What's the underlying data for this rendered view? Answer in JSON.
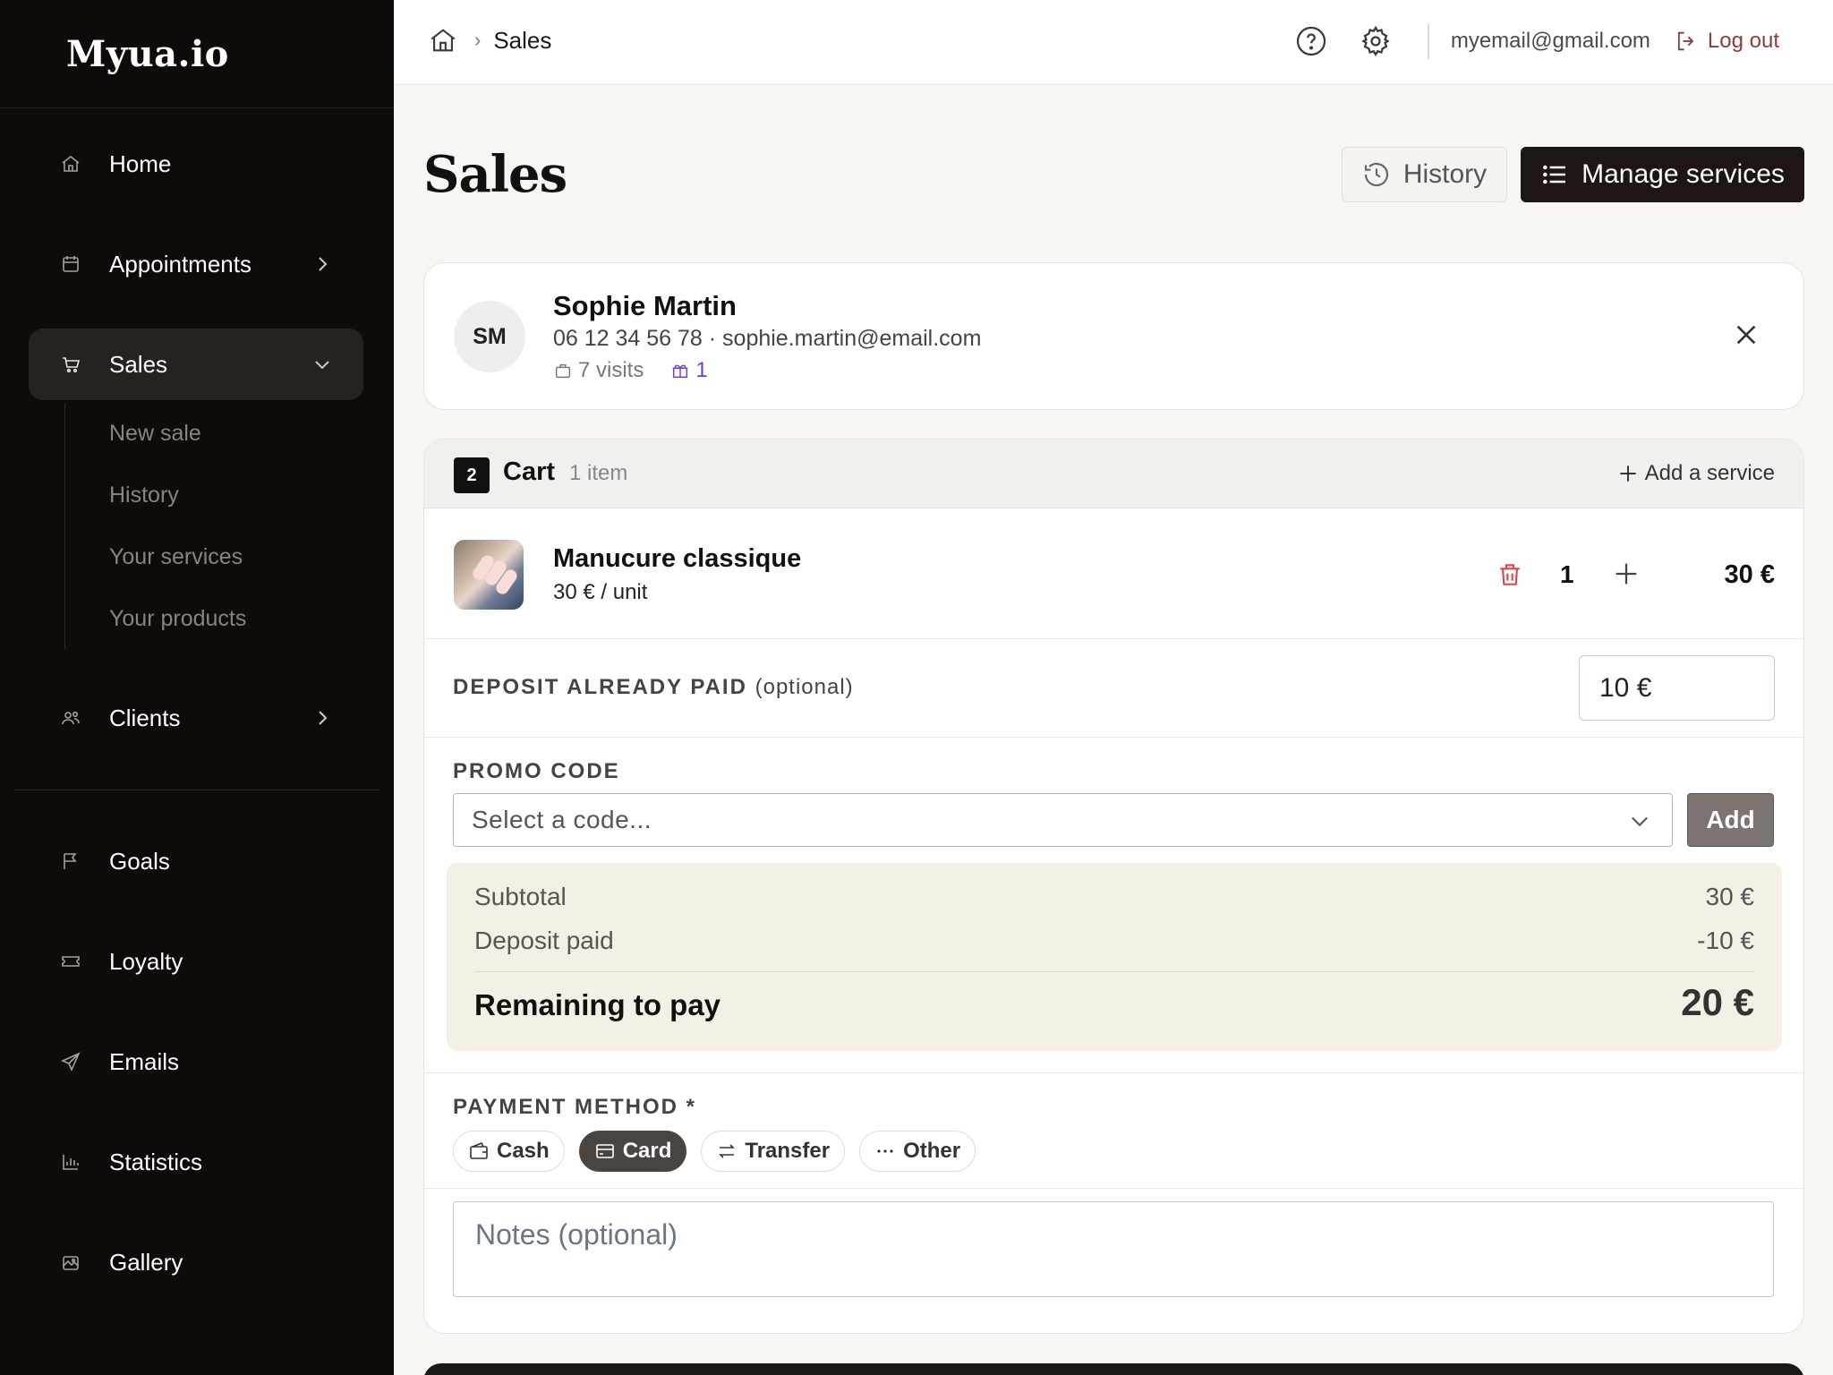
{
  "app": {
    "logo": "Myua.io"
  },
  "sidebar": {
    "items": [
      {
        "label": "Home",
        "icon": "home-icon"
      },
      {
        "label": "Appointments",
        "icon": "calendar-icon"
      },
      {
        "label": "Sales",
        "icon": "cart-icon"
      },
      {
        "label": "Clients",
        "icon": "users-icon"
      },
      {
        "label": "Goals",
        "icon": "flag-icon"
      },
      {
        "label": "Loyalty",
        "icon": "ticket-icon"
      },
      {
        "label": "Emails",
        "icon": "send-icon"
      },
      {
        "label": "Statistics",
        "icon": "chart-icon"
      },
      {
        "label": "Gallery",
        "icon": "gallery-icon"
      }
    ],
    "sales_sub": [
      "New sale",
      "History",
      "Your services",
      "Your products"
    ]
  },
  "topbar": {
    "breadcrumb": "Sales",
    "email": "myemail@gmail.com",
    "logout": "Log out"
  },
  "page": {
    "title": "Sales",
    "history_button": "History",
    "manage_button": "Manage services"
  },
  "client": {
    "initials": "SM",
    "name": "Sophie Martin",
    "contact": "06 12 34 56 78 · sophie.martin@email.com",
    "visits": "7 visits",
    "rewards": "1"
  },
  "cart": {
    "step": "2",
    "title": "Cart",
    "count": "1 item",
    "add_service": "Add a service",
    "items": [
      {
        "name": "Manucure classique",
        "unit_price": "30 € / unit",
        "qty": "1",
        "total": "30 €"
      }
    ],
    "deposit_label": "DEPOSIT ALREADY PAID",
    "deposit_optional": "(optional)",
    "deposit_value": "10 €",
    "promo_label": "PROMO CODE",
    "promo_placeholder": "Select a code...",
    "promo_add": "Add",
    "summary": {
      "subtotal_label": "Subtotal",
      "subtotal_value": "30 €",
      "deposit_label": "Deposit paid",
      "deposit_value": "-10 €",
      "remaining_label": "Remaining to pay",
      "remaining_value": "20 €"
    },
    "payment_label": "PAYMENT METHOD *",
    "payment_methods": [
      {
        "label": "Cash",
        "icon": "wallet-icon",
        "selected": false
      },
      {
        "label": "Card",
        "icon": "credit-card-icon",
        "selected": true
      },
      {
        "label": "Transfer",
        "icon": "transfer-icon",
        "selected": false
      },
      {
        "label": "Other",
        "icon": "more-icon",
        "selected": false
      }
    ],
    "notes_placeholder": "Notes (optional)"
  }
}
